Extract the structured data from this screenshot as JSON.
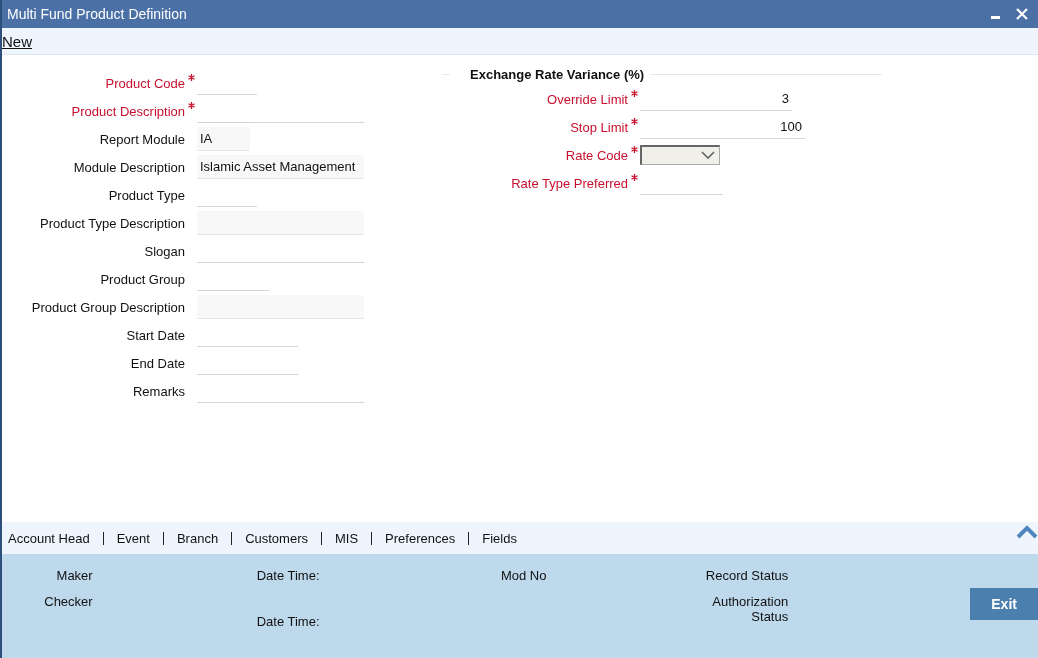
{
  "window": {
    "title": "Multi Fund Product Definition"
  },
  "toolbar": {
    "new_link": "New"
  },
  "main_fields": [
    {
      "label": "Product Code",
      "required": true,
      "kind": "text"
    },
    {
      "label": "Product Description",
      "required": true,
      "kind": "text"
    },
    {
      "label": "Report Module",
      "required": false,
      "kind": "readonly",
      "value": "IA"
    },
    {
      "label": "Module Description",
      "required": false,
      "kind": "readonly",
      "value": "Islamic Asset Management"
    },
    {
      "label": "Product Type",
      "required": false,
      "kind": "text"
    },
    {
      "label": "Product Type Description",
      "required": false,
      "kind": "readonly"
    },
    {
      "label": "Slogan",
      "required": false,
      "kind": "text"
    },
    {
      "label": "Product Group",
      "required": false,
      "kind": "text"
    },
    {
      "label": "Product Group Description",
      "required": false,
      "kind": "readonly"
    },
    {
      "label": "Start Date",
      "required": false,
      "kind": "text"
    },
    {
      "label": "End Date",
      "required": false,
      "kind": "text"
    },
    {
      "label": "Remarks",
      "required": false,
      "kind": "text"
    }
  ],
  "exchange_rate_variance": {
    "title": "Exchange Rate Variance (%)",
    "fields": [
      {
        "label": "Override Limit",
        "required": true,
        "kind": "number",
        "value": "3"
      },
      {
        "label": "Stop Limit",
        "required": true,
        "kind": "number",
        "value": "100"
      },
      {
        "label": "Rate Code",
        "required": true,
        "kind": "select"
      },
      {
        "label": "Rate Type Preferred",
        "required": true,
        "kind": "text"
      }
    ]
  },
  "tabs": [
    "Account Head",
    "Event",
    "Branch",
    "Customers",
    "MIS",
    "Preferences",
    "Fields"
  ],
  "audit": {
    "maker": "Maker",
    "checker": "Checker",
    "date_time_1": "Date Time:",
    "date_time_2": "Date Time:",
    "mod_no": "Mod No",
    "record_status": "Record Status",
    "authorization_status": "Authorization Status"
  },
  "buttons": {
    "exit": "Exit"
  }
}
